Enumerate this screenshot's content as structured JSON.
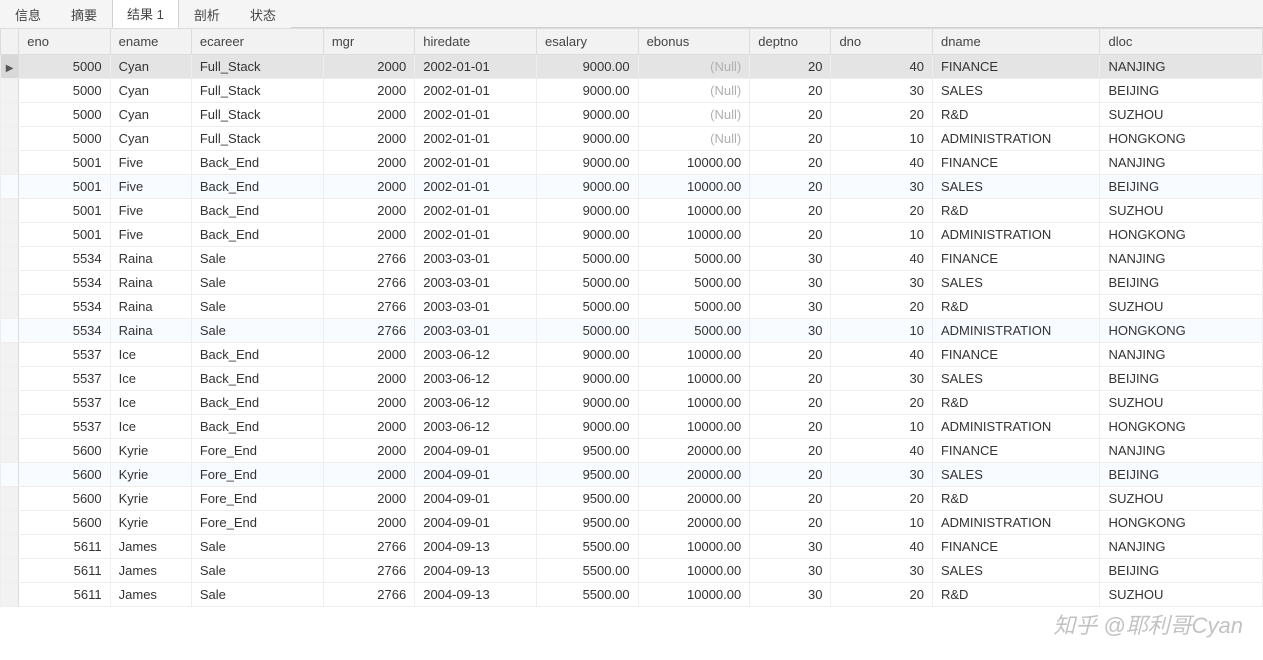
{
  "tabs": [
    {
      "label": "信息",
      "active": false
    },
    {
      "label": "摘要",
      "active": false
    },
    {
      "label": "结果 1",
      "active": true
    },
    {
      "label": "剖析",
      "active": false
    },
    {
      "label": "状态",
      "active": false
    }
  ],
  "null_display": "(Null)",
  "columns": [
    {
      "key": "eno",
      "label": "eno",
      "align": "num"
    },
    {
      "key": "ename",
      "label": "ename",
      "align": "txt"
    },
    {
      "key": "ecareer",
      "label": "ecareer",
      "align": "txt"
    },
    {
      "key": "mgr",
      "label": "mgr",
      "align": "num"
    },
    {
      "key": "hiredate",
      "label": "hiredate",
      "align": "txt"
    },
    {
      "key": "esalary",
      "label": "esalary",
      "align": "num"
    },
    {
      "key": "ebonus",
      "label": "ebonus",
      "align": "num"
    },
    {
      "key": "deptno",
      "label": "deptno",
      "align": "num"
    },
    {
      "key": "dno",
      "label": "dno",
      "align": "num"
    },
    {
      "key": "dname",
      "label": "dname",
      "align": "txt"
    },
    {
      "key": "dloc",
      "label": "dloc",
      "align": "txt"
    }
  ],
  "rows": [
    {
      "selected": true,
      "eno": 5000,
      "ename": "Cyan",
      "ecareer": "Full_Stack",
      "mgr": 2000,
      "hiredate": "2002-01-01",
      "esalary": "9000.00",
      "ebonus": null,
      "deptno": 20,
      "dno": 40,
      "dname": "FINANCE",
      "dloc": "NANJING"
    },
    {
      "eno": 5000,
      "ename": "Cyan",
      "ecareer": "Full_Stack",
      "mgr": 2000,
      "hiredate": "2002-01-01",
      "esalary": "9000.00",
      "ebonus": null,
      "deptno": 20,
      "dno": 30,
      "dname": "SALES",
      "dloc": "BEIJING"
    },
    {
      "eno": 5000,
      "ename": "Cyan",
      "ecareer": "Full_Stack",
      "mgr": 2000,
      "hiredate": "2002-01-01",
      "esalary": "9000.00",
      "ebonus": null,
      "deptno": 20,
      "dno": 20,
      "dname": "R&D",
      "dloc": "SUZHOU"
    },
    {
      "eno": 5000,
      "ename": "Cyan",
      "ecareer": "Full_Stack",
      "mgr": 2000,
      "hiredate": "2002-01-01",
      "esalary": "9000.00",
      "ebonus": null,
      "deptno": 20,
      "dno": 10,
      "dname": "ADMINISTRATION",
      "dloc": "HONGKONG"
    },
    {
      "eno": 5001,
      "ename": "Five",
      "ecareer": "Back_End",
      "mgr": 2000,
      "hiredate": "2002-01-01",
      "esalary": "9000.00",
      "ebonus": "10000.00",
      "deptno": 20,
      "dno": 40,
      "dname": "FINANCE",
      "dloc": "NANJING"
    },
    {
      "striped": true,
      "eno": 5001,
      "ename": "Five",
      "ecareer": "Back_End",
      "mgr": 2000,
      "hiredate": "2002-01-01",
      "esalary": "9000.00",
      "ebonus": "10000.00",
      "deptno": 20,
      "dno": 30,
      "dname": "SALES",
      "dloc": "BEIJING"
    },
    {
      "eno": 5001,
      "ename": "Five",
      "ecareer": "Back_End",
      "mgr": 2000,
      "hiredate": "2002-01-01",
      "esalary": "9000.00",
      "ebonus": "10000.00",
      "deptno": 20,
      "dno": 20,
      "dname": "R&D",
      "dloc": "SUZHOU"
    },
    {
      "eno": 5001,
      "ename": "Five",
      "ecareer": "Back_End",
      "mgr": 2000,
      "hiredate": "2002-01-01",
      "esalary": "9000.00",
      "ebonus": "10000.00",
      "deptno": 20,
      "dno": 10,
      "dname": "ADMINISTRATION",
      "dloc": "HONGKONG"
    },
    {
      "eno": 5534,
      "ename": "Raina",
      "ecareer": "Sale",
      "mgr": 2766,
      "hiredate": "2003-03-01",
      "esalary": "5000.00",
      "ebonus": "5000.00",
      "deptno": 30,
      "dno": 40,
      "dname": "FINANCE",
      "dloc": "NANJING"
    },
    {
      "eno": 5534,
      "ename": "Raina",
      "ecareer": "Sale",
      "mgr": 2766,
      "hiredate": "2003-03-01",
      "esalary": "5000.00",
      "ebonus": "5000.00",
      "deptno": 30,
      "dno": 30,
      "dname": "SALES",
      "dloc": "BEIJING"
    },
    {
      "eno": 5534,
      "ename": "Raina",
      "ecareer": "Sale",
      "mgr": 2766,
      "hiredate": "2003-03-01",
      "esalary": "5000.00",
      "ebonus": "5000.00",
      "deptno": 30,
      "dno": 20,
      "dname": "R&D",
      "dloc": "SUZHOU"
    },
    {
      "striped": true,
      "eno": 5534,
      "ename": "Raina",
      "ecareer": "Sale",
      "mgr": 2766,
      "hiredate": "2003-03-01",
      "esalary": "5000.00",
      "ebonus": "5000.00",
      "deptno": 30,
      "dno": 10,
      "dname": "ADMINISTRATION",
      "dloc": "HONGKONG"
    },
    {
      "eno": 5537,
      "ename": "Ice",
      "ecareer": "Back_End",
      "mgr": 2000,
      "hiredate": "2003-06-12",
      "esalary": "9000.00",
      "ebonus": "10000.00",
      "deptno": 20,
      "dno": 40,
      "dname": "FINANCE",
      "dloc": "NANJING"
    },
    {
      "eno": 5537,
      "ename": "Ice",
      "ecareer": "Back_End",
      "mgr": 2000,
      "hiredate": "2003-06-12",
      "esalary": "9000.00",
      "ebonus": "10000.00",
      "deptno": 20,
      "dno": 30,
      "dname": "SALES",
      "dloc": "BEIJING"
    },
    {
      "eno": 5537,
      "ename": "Ice",
      "ecareer": "Back_End",
      "mgr": 2000,
      "hiredate": "2003-06-12",
      "esalary": "9000.00",
      "ebonus": "10000.00",
      "deptno": 20,
      "dno": 20,
      "dname": "R&D",
      "dloc": "SUZHOU"
    },
    {
      "eno": 5537,
      "ename": "Ice",
      "ecareer": "Back_End",
      "mgr": 2000,
      "hiredate": "2003-06-12",
      "esalary": "9000.00",
      "ebonus": "10000.00",
      "deptno": 20,
      "dno": 10,
      "dname": "ADMINISTRATION",
      "dloc": "HONGKONG"
    },
    {
      "eno": 5600,
      "ename": "Kyrie",
      "ecareer": "Fore_End",
      "mgr": 2000,
      "hiredate": "2004-09-01",
      "esalary": "9500.00",
      "ebonus": "20000.00",
      "deptno": 20,
      "dno": 40,
      "dname": "FINANCE",
      "dloc": "NANJING"
    },
    {
      "striped": true,
      "eno": 5600,
      "ename": "Kyrie",
      "ecareer": "Fore_End",
      "mgr": 2000,
      "hiredate": "2004-09-01",
      "esalary": "9500.00",
      "ebonus": "20000.00",
      "deptno": 20,
      "dno": 30,
      "dname": "SALES",
      "dloc": "BEIJING"
    },
    {
      "eno": 5600,
      "ename": "Kyrie",
      "ecareer": "Fore_End",
      "mgr": 2000,
      "hiredate": "2004-09-01",
      "esalary": "9500.00",
      "ebonus": "20000.00",
      "deptno": 20,
      "dno": 20,
      "dname": "R&D",
      "dloc": "SUZHOU"
    },
    {
      "eno": 5600,
      "ename": "Kyrie",
      "ecareer": "Fore_End",
      "mgr": 2000,
      "hiredate": "2004-09-01",
      "esalary": "9500.00",
      "ebonus": "20000.00",
      "deptno": 20,
      "dno": 10,
      "dname": "ADMINISTRATION",
      "dloc": "HONGKONG"
    },
    {
      "eno": 5611,
      "ename": "James",
      "ecareer": "Sale",
      "mgr": 2766,
      "hiredate": "2004-09-13",
      "esalary": "5500.00",
      "ebonus": "10000.00",
      "deptno": 30,
      "dno": 40,
      "dname": "FINANCE",
      "dloc": "NANJING"
    },
    {
      "eno": 5611,
      "ename": "James",
      "ecareer": "Sale",
      "mgr": 2766,
      "hiredate": "2004-09-13",
      "esalary": "5500.00",
      "ebonus": "10000.00",
      "deptno": 30,
      "dno": 30,
      "dname": "SALES",
      "dloc": "BEIJING"
    },
    {
      "eno": 5611,
      "ename": "James",
      "ecareer": "Sale",
      "mgr": 2766,
      "hiredate": "2004-09-13",
      "esalary": "5500.00",
      "ebonus": "10000.00",
      "deptno": 30,
      "dno": 20,
      "dname": "R&D",
      "dloc": "SUZHOU"
    }
  ],
  "watermark": "知乎 @耶利哥Cyan"
}
